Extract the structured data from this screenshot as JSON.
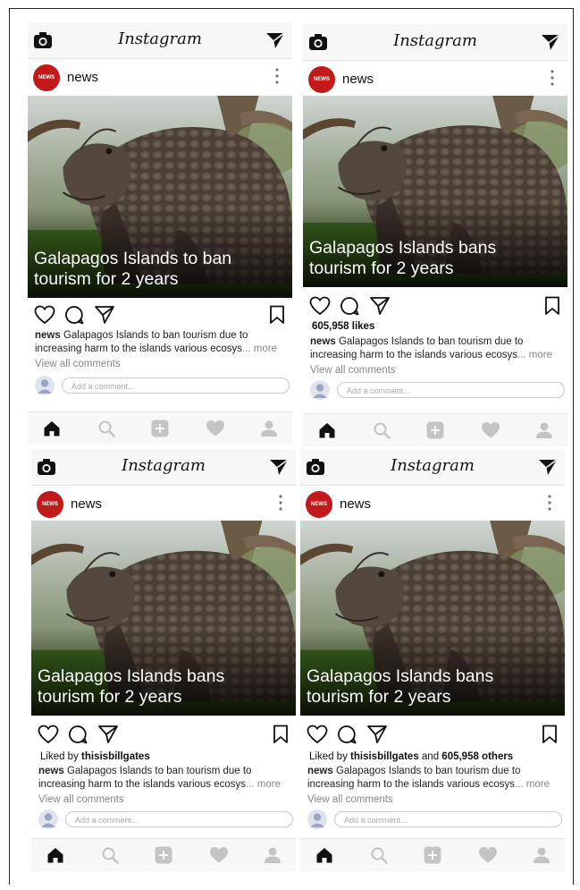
{
  "app": {
    "brand": "Instagram"
  },
  "colors": {
    "avatar_red": "#c21a1a",
    "nav_gray": "#c4c4c4"
  },
  "icons": [
    "camera-icon",
    "send-icon",
    "more-dots-icon",
    "heart-icon",
    "comment-icon",
    "share-icon",
    "bookmark-icon",
    "home-icon",
    "search-icon",
    "add-icon",
    "activity-icon",
    "profile-icon"
  ],
  "panels": [
    {
      "username": "news",
      "avatar_text": "NEWS",
      "headline_line1": "Galapagos Islands to ban",
      "headline_line2": "tourism for 2 years",
      "likes_prefix": "",
      "likes_name": "",
      "likes_mid": "",
      "likes_count": "",
      "caption_user": "news",
      "caption_text": "Galapagos Islands to ban tourism due to increasing harm to the islands various ecosys",
      "caption_more": "... more",
      "view_comments": "View all comments",
      "comment_placeholder": "Add a comment..."
    },
    {
      "username": "news",
      "avatar_text": "NEWS",
      "headline_line1": "Galapagos Islands bans",
      "headline_line2": "tourism for 2 years",
      "likes_prefix": "",
      "likes_name": "",
      "likes_mid": "",
      "likes_count": "605,958 likes",
      "caption_user": "news",
      "caption_text": "Galapagos Islands to ban tourism due to increasing harm to the islands various ecosys",
      "caption_more": "... more",
      "view_comments": "View all comments",
      "comment_placeholder": "Add a comment..."
    },
    {
      "username": "news",
      "avatar_text": "NEWS",
      "headline_line1": "Galapagos Islands bans",
      "headline_line2": "tourism for 2 years",
      "likes_prefix": "Liked by ",
      "likes_name": "thisisbillgates",
      "likes_mid": "",
      "likes_count": "",
      "caption_user": "news",
      "caption_text": "Galapagos Islands to ban tourism due to increasing harm to the islands various ecosys",
      "caption_more": "... more",
      "view_comments": "View all comments",
      "comment_placeholder": "Add a comment..."
    },
    {
      "username": "news",
      "avatar_text": "NEWS",
      "headline_line1": "Galapagos Islands bans",
      "headline_line2": "tourism for 2 years",
      "likes_prefix": "Liked by ",
      "likes_name": "thisisbillgates",
      "likes_mid": " and ",
      "likes_count": "605,958 others",
      "caption_user": "news",
      "caption_text": "Galapagos Islands to ban tourism due to increasing harm to the islands various ecosys",
      "caption_more": "... more",
      "view_comments": "View all comments",
      "comment_placeholder": "Add a comment..."
    }
  ]
}
